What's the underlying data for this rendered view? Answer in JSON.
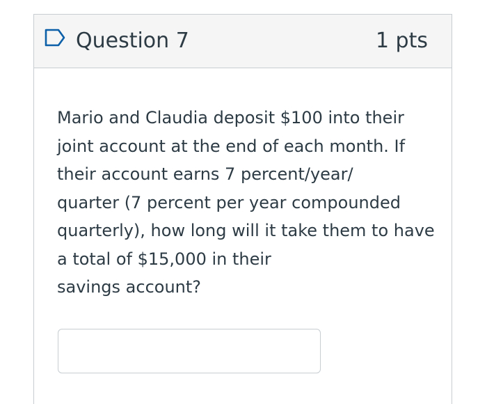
{
  "question": {
    "title": "Question 7",
    "points": "1 pts",
    "flag_icon": "flag-outline-icon",
    "text_lines": [
      "Mario and Claudia deposit $100 into their",
      "joint account at the end of each month. If",
      "their account earns 7 percent/year/",
      "quarter (7 percent per year compounded",
      "quarterly), how long will it take them to have",
      "a total of $15,000 in their",
      "savings account?"
    ],
    "answer_value": "",
    "answer_placeholder": ""
  },
  "colors": {
    "header_bg": "#f5f5f5",
    "border": "#c7cdd1",
    "text": "#2d3b45",
    "flag_stroke": "#0b5fa8"
  }
}
